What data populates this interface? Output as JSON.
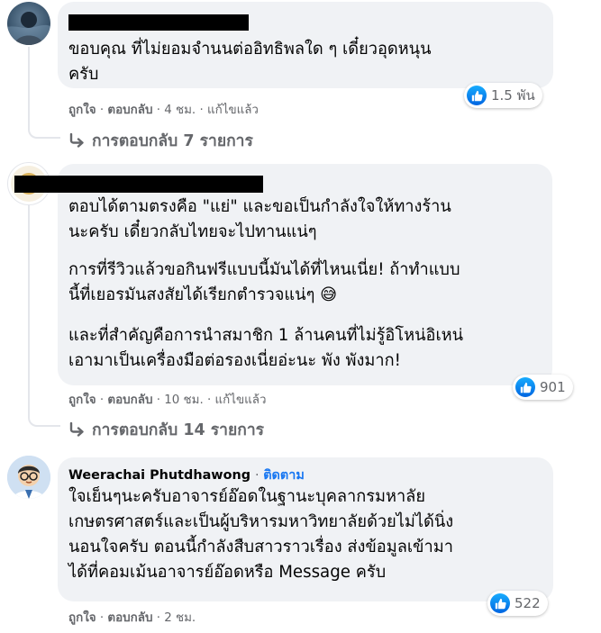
{
  "comments": [
    {
      "paragraphs": [
        "ขอบคุณ ที่ไม่ยอมจำนนต่ออิทธิพลใด ๆ เดี๋ยวอุดหนุน\nครับ"
      ],
      "reactions": "1.5 พัน",
      "actions": {
        "like": "ถูกใจ",
        "reply": "ตอบกลับ",
        "time": "4 ชม.",
        "edited": "แก้ไขแล้ว"
      },
      "replies": "การตอบกลับ 7 รายการ"
    },
    {
      "paragraphs": [
        "ตอบได้ตามตรงคือ \"แย่\" และขอเป็นกำลังใจให้ทางร้าน\nนะครับ เดี๋ยวกลับไทยจะไปทานแน่ๆ",
        "การที่รีวิวแล้วขอกินฟรีแบบนี้มันได้ที่ไหนเนี่ย! ถ้าทำแบบ\nนี้ที่เยอรมันสงสัยได้เรียกตำรวจแน่ๆ 😅",
        "และที่สำคัญคือการนำสมาชิก 1 ล้านคนที่ไม่รู้อิโหน่อิเหน่\nเอามาเป็นเครื่องมือต่อรองเนี่ยอ่ะนะ พัง พังมาก!"
      ],
      "reactions": "901",
      "actions": {
        "like": "ถูกใจ",
        "reply": "ตอบกลับ",
        "time": "10 ชม.",
        "edited": "แก้ไขแล้ว"
      },
      "replies": "การตอบกลับ 14 รายการ"
    },
    {
      "author": "Weerachai Phutdhawong",
      "follow": "ติดตาม",
      "paragraphs": [
        "ใจเย็นๆนะครับอาจารย์อ๊อดในฐานะบุคลากรมหาลัย\nเกษตรศาสตร์และเป็นผู้บริหารมหาวิทยาลัยด้วยไม่ได้นิ่ง\nนอนใจครับ ตอนนี้กำลังสืบสาวราวเรื่อง ส่งข้อมูลเข้ามา\nได้ที่คอมเม้นอาจารย์อ๊อดหรือ Message ครับ"
      ],
      "reactions": "522",
      "actions": {
        "like": "ถูกใจ",
        "reply": "ตอบกลับ",
        "time": "2 ชม."
      }
    }
  ],
  "colors": {
    "bubble": "#f0f2f5",
    "secondary_text": "#65676b",
    "link": "#1877f2",
    "like_blue": "#1877f2"
  },
  "icons": [
    "like-icon",
    "reply-arrow-icon"
  ]
}
